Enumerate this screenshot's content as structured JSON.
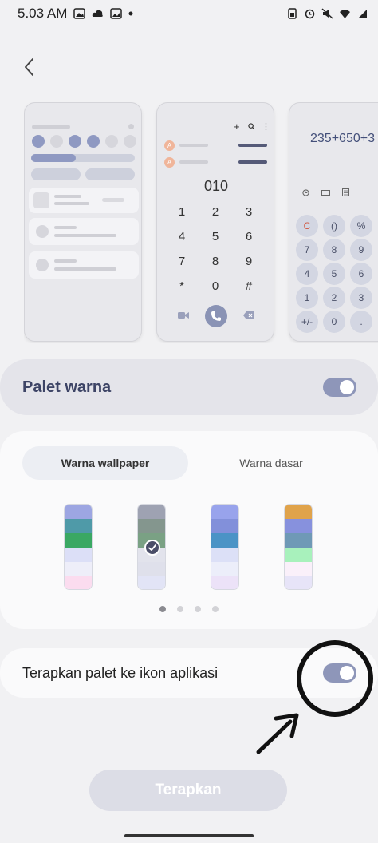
{
  "status_bar": {
    "time": "5.03 AM",
    "left_icons": [
      "gallery-icon",
      "cloud-icon",
      "image-icon",
      "dot-icon"
    ],
    "right_icons": [
      "battery-saver-icon",
      "alarm-icon",
      "mute-icon",
      "wifi-icon",
      "signal-icon"
    ]
  },
  "nav": {
    "back_icon": "chevron-left-icon"
  },
  "previews": {
    "dialer": {
      "number": "010",
      "contact_initials": [
        "A",
        "A"
      ],
      "keys": [
        "1",
        "2",
        "3",
        "4",
        "5",
        "6",
        "7",
        "8",
        "9",
        "*",
        "0",
        "#"
      ]
    },
    "calculator": {
      "expression": "235+650+3",
      "keys": [
        "C",
        "()",
        "%",
        "7",
        "8",
        "9",
        "4",
        "5",
        "6",
        "1",
        "2",
        "3",
        "+/-",
        "0",
        "."
      ]
    }
  },
  "palette_toggle": {
    "label": "Palet warna",
    "on": true
  },
  "palette_tabs": {
    "active": "Warna wallpaper",
    "inactive": "Warna dasar"
  },
  "swatches": [
    {
      "colors": [
        "#9da6e2",
        "#4f9aa8",
        "#3aa863",
        "#dcdff7",
        "#eeeef9",
        "#fbdcef"
      ],
      "selected": false
    },
    {
      "colors": [
        "#9ea2b2",
        "#84968e",
        "#7aa184",
        "#e2e3ec",
        "#dfe0eb",
        "#e2e4f6"
      ],
      "selected": true
    },
    {
      "colors": [
        "#98a3ec",
        "#8290da",
        "#4b93c6",
        "#dce0f7",
        "#eceefa",
        "#ece2f8"
      ],
      "selected": false
    },
    {
      "colors": [
        "#e0a34b",
        "#8791dd",
        "#6f99b6",
        "#a8f1bc",
        "#faf0fa",
        "#e7e4f8"
      ],
      "selected": false
    }
  ],
  "page_dots": {
    "count": 4,
    "active_index": 0
  },
  "apply_icon_toggle": {
    "label": "Terapkan palet ke ikon aplikasi",
    "on": true
  },
  "apply_button": {
    "label": "Terapkan",
    "enabled": false
  }
}
